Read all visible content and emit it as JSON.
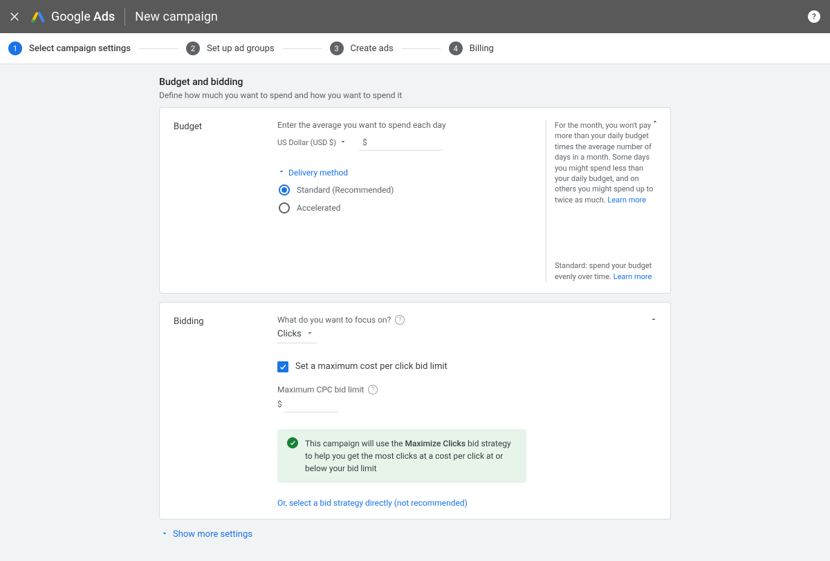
{
  "header": {
    "brand_google": "Google",
    "brand_ads": "Ads",
    "page_title": "New campaign"
  },
  "stepper": {
    "steps": [
      {
        "num": "1",
        "label": "Select campaign settings"
      },
      {
        "num": "2",
        "label": "Set up ad groups"
      },
      {
        "num": "3",
        "label": "Create ads"
      },
      {
        "num": "4",
        "label": "Billing"
      }
    ]
  },
  "section": {
    "heading": "Budget and bidding",
    "sub": "Define how much you want to spend and how you want to spend it"
  },
  "budget": {
    "title": "Budget",
    "hint": "Enter the average you want to spend each day",
    "currency_label": "US Dollar (USD $)",
    "currency_symbol": "$",
    "side_text": "For the month, you won't pay more than your daily budget times the average number of days in a month. Some days you might spend less than your daily budget, and on others you might spend up to twice as much.",
    "side_link": "Learn more",
    "expand_label": "Delivery method",
    "radio_1": "Standard (Recommended)",
    "radio_2": "Accelerated",
    "delivery_side": "Standard: spend your budget evenly over time.",
    "delivery_link": "Learn more"
  },
  "bidding": {
    "title": "Bidding",
    "focus_label": "What do you want to focus on?",
    "focus_value": "Clicks",
    "checkbox_label": "Set a maximum cost per click bid limit",
    "max_cpc_label": "Maximum CPC bid limit",
    "currency_symbol": "$",
    "info_pre": "This campaign will use the ",
    "info_bold": "Maximize Clicks",
    "info_post": " bid strategy to help you get the most clicks at a cost per click at or below your bid limit",
    "alt_link": "Or, select a bid strategy directly (not recommended)"
  },
  "show_more": "Show more settings"
}
